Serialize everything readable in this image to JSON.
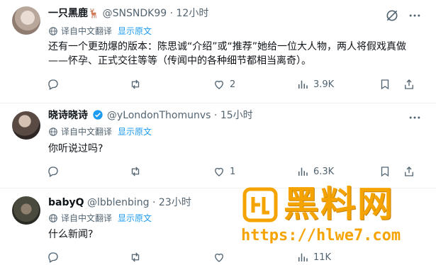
{
  "tweets": [
    {
      "name": "一只黑鹿",
      "name_emoji": "🦌",
      "handle": "@SNSNDK99",
      "dot": "·",
      "time": "12小时",
      "translate_label": "译自中文翻译",
      "show_original": "显示原文",
      "text": "还有一个更劲爆的版本：陈思诚“介绍”或“推荐”她给一位大人物，两人将假戏真做——怀孕、正式交往等等（传闻中的各种细节都相当离奇）。",
      "replies": "",
      "retweets": "",
      "likes": "2",
      "views": "3.9K"
    },
    {
      "name": "晓诗晓诗",
      "name_emoji": "",
      "handle": "@yLondonThomunvs",
      "dot": "·",
      "time": "15小时",
      "translate_label": "译自中文翻译",
      "show_original": "显示原文",
      "text": "你听说过吗?",
      "replies": "",
      "retweets": "",
      "likes": "1",
      "views": "6.3K"
    },
    {
      "name": "babyQ",
      "name_emoji": "",
      "handle": "@lbblenbing",
      "dot": "·",
      "time": "23小时",
      "translate_label": "译自中文翻译",
      "show_original": "显示原文",
      "text": "什么新闻?",
      "replies": "",
      "retweets": "",
      "likes": "",
      "views": "11K"
    }
  ],
  "watermark": {
    "title": "黑料网",
    "url": "https://hlwe7.com"
  },
  "colors": {
    "accent": "#1d9bf0",
    "secondary_text": "#536471",
    "watermark": "#f5a300"
  },
  "icons": [
    "more-icon",
    "grok-icon",
    "globe-icon",
    "reply-icon",
    "retweet-icon",
    "like-icon",
    "views-icon",
    "bookmark-icon",
    "share-icon",
    "verified-icon"
  ]
}
